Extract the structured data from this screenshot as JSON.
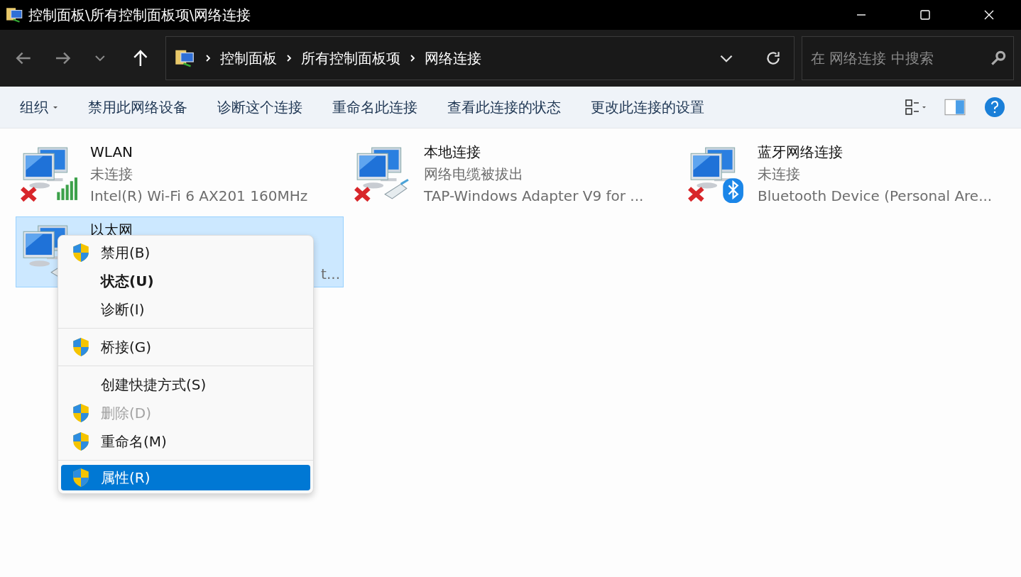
{
  "window": {
    "title": "控制面板\\所有控制面板项\\网络连接"
  },
  "address": {
    "breadcrumbs": [
      "控制面板",
      "所有控制面板项",
      "网络连接"
    ]
  },
  "search": {
    "placeholder": "在 网络连接 中搜索"
  },
  "commands": [
    {
      "label": "组织",
      "dropdown": true
    },
    {
      "label": "禁用此网络设备",
      "dropdown": false
    },
    {
      "label": "诊断这个连接",
      "dropdown": false
    },
    {
      "label": "重命名此连接",
      "dropdown": false
    },
    {
      "label": "查看此连接的状态",
      "dropdown": false
    },
    {
      "label": "更改此连接的设置",
      "dropdown": false
    }
  ],
  "connections": [
    {
      "name": "WLAN",
      "status": "未连接",
      "adapter": "Intel(R) Wi-Fi 6 AX201 160MHz",
      "kind": "wifi",
      "disconnected": true,
      "selected": false
    },
    {
      "name": "本地连接",
      "status": "网络电缆被拔出",
      "adapter": "TAP-Windows Adapter V9 for ...",
      "kind": "cable",
      "disconnected": true,
      "selected": false
    },
    {
      "name": "蓝牙网络连接",
      "status": "未连接",
      "adapter": "Bluetooth Device (Personal Are...",
      "kind": "bluetooth",
      "disconnected": true,
      "selected": false
    },
    {
      "name": "以太网",
      "adapter": "t...",
      "kind": "cable",
      "disconnected": false,
      "selected": true
    }
  ],
  "context_menu": {
    "groups": [
      [
        {
          "label": "禁用(B)",
          "shield": true,
          "default": false,
          "disabled": false,
          "selected": false
        },
        {
          "label": "状态(U)",
          "shield": false,
          "default": true,
          "disabled": false,
          "selected": false
        },
        {
          "label": "诊断(I)",
          "shield": false,
          "default": false,
          "disabled": false,
          "selected": false
        }
      ],
      [
        {
          "label": "桥接(G)",
          "shield": true,
          "default": false,
          "disabled": false,
          "selected": false
        }
      ],
      [
        {
          "label": "创建快捷方式(S)",
          "shield": false,
          "default": false,
          "disabled": false,
          "selected": false
        },
        {
          "label": "删除(D)",
          "shield": true,
          "default": false,
          "disabled": true,
          "selected": false
        },
        {
          "label": "重命名(M)",
          "shield": true,
          "default": false,
          "disabled": false,
          "selected": false
        }
      ],
      [
        {
          "label": "属性(R)",
          "shield": true,
          "default": false,
          "disabled": false,
          "selected": true
        }
      ]
    ]
  }
}
